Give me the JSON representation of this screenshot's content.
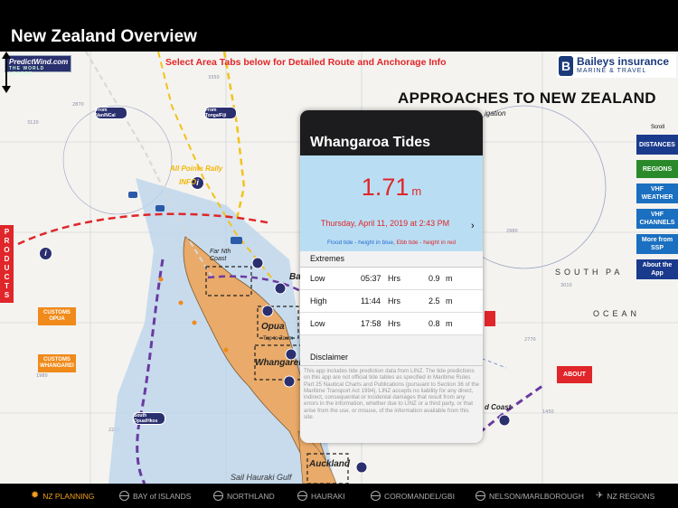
{
  "header": {
    "title": "New Zealand Overview"
  },
  "map": {
    "select_message": "Select Area Tabs below for Detailed Route and Anchorage Info",
    "predictwind_logo": {
      "name": "PredictWind.com",
      "tagline": "THE WORLD LEADER"
    },
    "baileys_logo": {
      "name": "Baileys insurance",
      "tagline": "MARINE & TRAVEL"
    },
    "approaches_title": "APPROACHES TO NEW ZEALAND",
    "navigation_fragment": "igation",
    "scroll_label": "Scroll",
    "products_label": "PRODUCTS",
    "side_buttons": [
      {
        "label": "DISTANCES",
        "color": "#1a3a8c"
      },
      {
        "label": "REGIONS",
        "color": "#2a8a2a"
      },
      {
        "label": "VHF WEATHER",
        "color": "#1a6fc0"
      },
      {
        "label": "VHF CHANNELS",
        "color": "#1a6fc0"
      },
      {
        "label": "More from SSP",
        "color": "#1a6fc0"
      },
      {
        "label": "About the App",
        "color": "#1a3a8c"
      }
    ],
    "customs": [
      {
        "label": "CUSTOMS OPUA"
      },
      {
        "label": "CUSTOMS WHANGAREI"
      }
    ],
    "about_label": "ABOUT",
    "route_pins": [
      {
        "label": "From Van/NCal"
      },
      {
        "label": "From Tonga/Fiji"
      },
      {
        "label": "South Opua/Hkos"
      }
    ],
    "all_points_rally": "All Points Rally",
    "info_label": "INFO",
    "place_labels": [
      {
        "text": "Far Nth Coast"
      },
      {
        "text": "Opua"
      },
      {
        "text": "Tap to Zoom"
      },
      {
        "text": "Whangarei"
      },
      {
        "text": "Auckland"
      },
      {
        "text": "Sail Hauraki Gulf"
      },
      {
        "text": "d Coast"
      },
      {
        "text": "Ba"
      }
    ],
    "ocean_labels": [
      "SOUTH",
      "PA",
      "OCEAN"
    ]
  },
  "tide_popup": {
    "title": "Whangaroa Tides",
    "height_value": "1.71",
    "height_unit": "m",
    "datetime": "Thursday, April 11, 2019 at 2:43 PM",
    "legend_flood": "Flood tide - height in blue",
    "legend_ebb": "Ebb tide - height in red",
    "extremes_header": "Extremes",
    "extremes": [
      {
        "type": "Low",
        "time": "05:37",
        "hrs": "Hrs",
        "height": "0.9",
        "unit": "m"
      },
      {
        "type": "High",
        "time": "11:44",
        "hrs": "Hrs",
        "height": "2.5",
        "unit": "m"
      },
      {
        "type": "Low",
        "time": "17:58",
        "hrs": "Hrs",
        "height": "0.8",
        "unit": "m"
      }
    ],
    "disclaimer_header": "Disclaimer",
    "disclaimer_text": "This app includes tide prediction data from LINZ. The tide predictions on this app are not official tide tables as specified in Maritime Rules Part 25 Nautical Charts and Publications (pursuant to Section 36 of the Maritime Transport Act 1994). LINZ accepts no liability for any direct, indirect, consequential or incidental damages that result from any errors in the information, whether due to LINZ or a third party, or that arise from the use, or misuse, of the information available from this site."
  },
  "tabs": [
    {
      "label": "NZ PLANNING",
      "icon": "sun-icon",
      "active": true
    },
    {
      "label": "BAY of ISLANDS",
      "icon": "globe-icon",
      "active": false
    },
    {
      "label": "NORTHLAND",
      "icon": "globe-icon",
      "active": false
    },
    {
      "label": "HAURAKI",
      "icon": "globe-icon",
      "active": false
    },
    {
      "label": "COROMANDEL/GBI",
      "icon": "globe-icon",
      "active": false
    },
    {
      "label": "NELSON/MARLBOROUGH",
      "icon": "globe-icon",
      "active": false
    },
    {
      "label": "NZ REGIONS",
      "icon": "plane-icon",
      "active": false
    }
  ],
  "colors": {
    "accent": "#f0a020",
    "alert_red": "#e0262a",
    "tide_blue": "#b9def3",
    "land": "#e9aa6a"
  }
}
